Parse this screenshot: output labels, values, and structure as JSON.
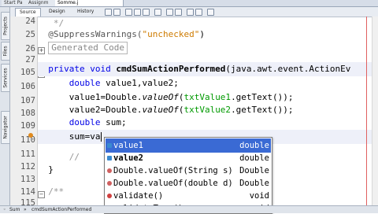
{
  "file_tabs": [
    {
      "label": "Start Pa"
    },
    {
      "label": "Assignm"
    },
    {
      "label": "Somme.j"
    }
  ],
  "view_tabs": {
    "source": "Source",
    "design": "Design",
    "history": "History"
  },
  "side_panels": [
    "Projects",
    "Files",
    "Services",
    "Navigator"
  ],
  "gutter": {
    "line_numbers": [
      "24",
      "25",
      "26",
      "27",
      "105",
      "106",
      "107",
      "108",
      "109",
      "110",
      "111",
      "112",
      "113",
      "114",
      "115",
      "116",
      "117"
    ]
  },
  "code": {
    "l24": "*/",
    "l25_ann": "@SuppressWarnings(",
    "l25_str": "\"unchecked\"",
    "l25_end": ")",
    "l26_fold": "Generated Code",
    "l106_kw": "private void ",
    "l106_method": "cmdSumActionPerformed",
    "l106_rest": "(java.awt.event.ActionEv",
    "l107_kw": "double ",
    "l107_rest": "value1,value2;",
    "l108_a": "value1=Double.",
    "l108_it": "valueOf",
    "l108_b": "(",
    "l108_fld": "txtValue1",
    "l108_c": ".getText());",
    "l109_a": "value2=Double.",
    "l109_it": "valueOf",
    "l109_b": "(",
    "l109_fld": "txtValue2",
    "l109_c": ".getText());",
    "l110_kw": "double ",
    "l110_rest": "sum;",
    "l111": "sum=va",
    "l113_cmt": "// ",
    "l113_tail": "s:",
    "l114": "}",
    "l116_cmt": "/**"
  },
  "completion": {
    "items": [
      {
        "name": "value1",
        "type": "double",
        "kind": "field"
      },
      {
        "name": "value2",
        "type": "double",
        "kind": "field"
      },
      {
        "name": "Double.valueOf(String s)",
        "type": "Double",
        "kind": "static-method"
      },
      {
        "name": "Double.valueOf(double d)",
        "type": "Double",
        "kind": "static-method"
      },
      {
        "name": "validate()",
        "type": "void",
        "kind": "method"
      },
      {
        "name": "validateTree()",
        "type": "void",
        "kind": "method"
      }
    ],
    "selected_index": 0
  },
  "status": {
    "crumb1": "Sum",
    "crumb2": "cmdSumActionPerformed"
  },
  "colors": {
    "keyword": "#0000e6",
    "string": "#ce7b00",
    "field": "#009900",
    "selection": "#3a6ad4",
    "current_line": "#eef0f9"
  }
}
